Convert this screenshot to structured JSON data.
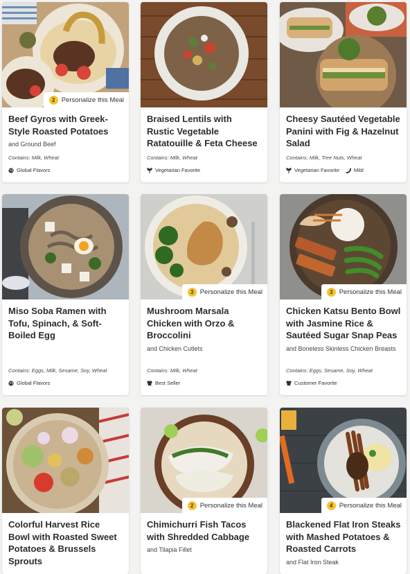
{
  "cards": [
    {
      "title": "Beef Gyros with Greek-Style Roasted Potatoes",
      "subtitle": "and Ground Beef",
      "contains": "Contains: Milk, Wheat",
      "badge": {
        "num": "2",
        "label": "Personalize this Meal"
      },
      "tags": [
        {
          "icon": "globe-icon",
          "label": "Global Flavors"
        }
      ]
    },
    {
      "title": "Braised Lentils with Rustic Vegetable Ratatouille & Feta Cheese",
      "subtitle": "",
      "contains": "Contains: Milk, Wheat",
      "badge": null,
      "tags": [
        {
          "icon": "sprout-icon",
          "label": "Vegetarian Favorite"
        }
      ]
    },
    {
      "title": "Cheesy Sautéed Vegetable Panini with Fig & Hazelnut Salad",
      "subtitle": "",
      "contains": "Contains: Milk, Tree Nuts, Wheat",
      "badge": null,
      "tags": [
        {
          "icon": "sprout-icon",
          "label": "Vegetarian Favorite"
        },
        {
          "icon": "chili-icon",
          "label": "Mild"
        }
      ]
    },
    {
      "title": "Miso Soba Ramen with Tofu, Spinach, & Soft-Boiled Egg",
      "subtitle": "",
      "contains": "Contains: Eggs, Milk, Sesame, Soy, Wheat",
      "badge": null,
      "tags": [
        {
          "icon": "globe-icon",
          "label": "Global Flavors"
        }
      ]
    },
    {
      "title": "Mushroom Marsala Chicken with Orzo & Broccolini",
      "subtitle": "and Chicken Cutlets",
      "contains": "Contains: Milk, Wheat",
      "badge": {
        "num": "3",
        "label": "Personalize this Meal"
      },
      "tags": [
        {
          "icon": "chef-icon",
          "label": "Best Seller"
        }
      ]
    },
    {
      "title": "Chicken Katsu Bento Bowl with Jasmine Rice & Sautéed Sugar Snap Peas",
      "subtitle": "and Boneless Skinless Chicken Breasts",
      "contains": "Contains: Eggs, Sesame, Soy, Wheat",
      "badge": {
        "num": "3",
        "label": "Personalize this Meal"
      },
      "tags": [
        {
          "icon": "chef-icon",
          "label": "Customer Favorite"
        }
      ]
    },
    {
      "title": "Colorful Harvest Rice Bowl with Roasted Sweet Potatoes & Brussels Sprouts",
      "subtitle": "",
      "contains": "",
      "badge": null,
      "tags": []
    },
    {
      "title": "Chimichurri Fish Tacos with Shredded Cabbage",
      "subtitle": "and Tilapia Fillet",
      "contains": "",
      "badge": {
        "num": "2",
        "label": "Personalize this Meal"
      },
      "tags": []
    },
    {
      "title": "Blackened Flat Iron Steaks with Mashed Potatoes & Roasted Carrots",
      "subtitle": "and Flat Iron Steak",
      "contains": "",
      "badge": {
        "num": "4",
        "label": "Personalize this Meal"
      },
      "tags": []
    }
  ]
}
